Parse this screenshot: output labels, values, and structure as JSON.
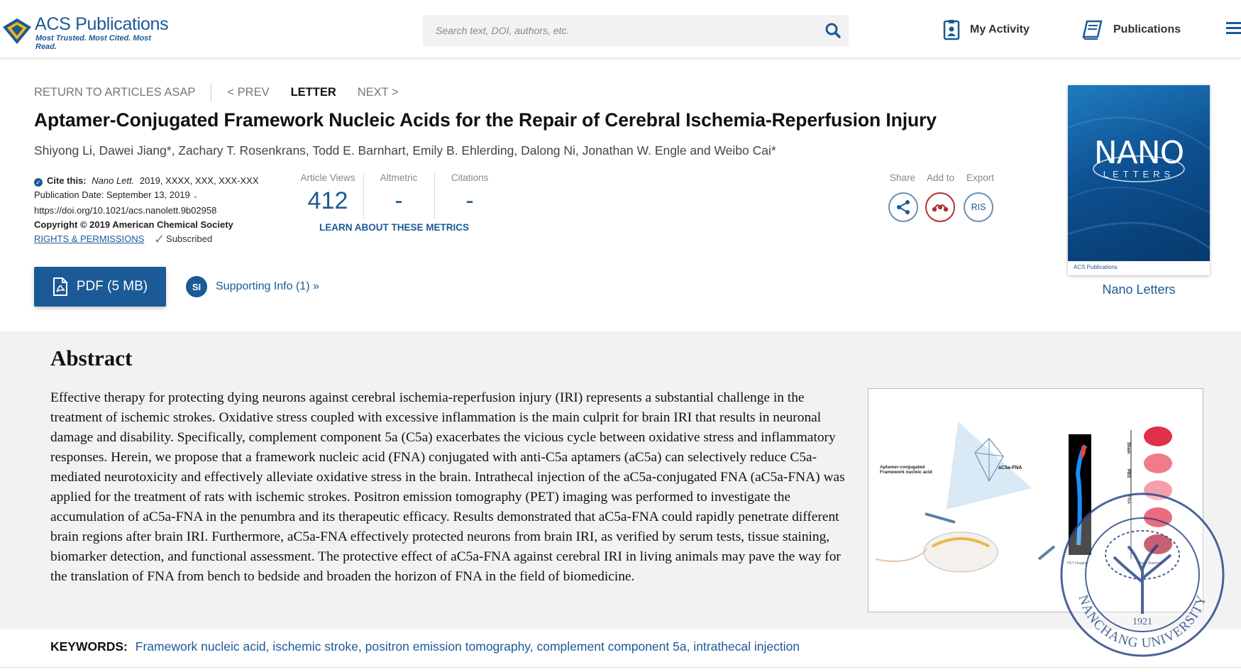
{
  "header": {
    "logo_name": "ACS Publications",
    "logo_tagline": "Most Trusted. Most Cited. Most Read.",
    "search_placeholder": "Search text, DOI, authors, etc.",
    "my_activity": "My Activity",
    "publications": "Publications",
    "brand_color": "#1b5a96"
  },
  "article_nav": {
    "return": "RETURN TO ARTICLES ASAP",
    "prev": "< PREV",
    "type": "LETTER",
    "next": "NEXT >"
  },
  "article": {
    "title": "Aptamer-Conjugated Framework Nucleic Acids for the Repair of Cerebral Ischemia-Reperfusion Injury",
    "authors": "Shiyong Li, Dawei Jiang*, Zachary T. Rosenkrans, Todd E. Barnhart, Emily B. Ehlerding, Dalong Ni, Jonathan W. Engle and Weibo Cai*"
  },
  "cite": {
    "label": "Cite this:",
    "journal": "Nano Lett.",
    "ref": "2019, XXXX, XXX, XXX-XXX",
    "pub_date": "Publication Date: September 13, 2019",
    "doi": "https://doi.org/10.1021/acs.nanolett.9b02958",
    "copyright": "Copyright © 2019 American Chemical Society",
    "rights": "RIGHTS & PERMISSIONS",
    "subscribed": "Subscribed"
  },
  "metrics": {
    "views_label": "Article Views",
    "views": "412",
    "altmetric_label": "Altmetric",
    "altmetric": "-",
    "citations_label": "Citations",
    "citations": "-",
    "learn": "LEARN ABOUT THESE METRICS"
  },
  "actions": {
    "share": "Share",
    "add_to": "Add to",
    "export": "Export",
    "ris": "RIS"
  },
  "buttons": {
    "pdf": "PDF (5 MB)",
    "si_badge": "SI",
    "supporting": "Supporting Info (1) »"
  },
  "journal": {
    "cover_title": "NANO",
    "cover_subtitle": "LETTERS",
    "cover_footer": "ACS Publications",
    "name": "Nano Letters"
  },
  "abstract": {
    "heading": "Abstract",
    "text": "Effective therapy for protecting dying neurons against cerebral ischemia-reperfusion injury (IRI) represents a substantial challenge in the treatment of ischemic strokes. Oxidative stress coupled with excessive inflammation is the main culprit for brain IRI that results in neuronal damage and disability. Specifically, complement component 5a (C5a) exacerbates the vicious cycle between oxidative stress and inflammatory responses. Herein, we propose that a framework nucleic acid (FNA) conjugated with anti-C5a aptamers (aC5a) can selectively reduce C5a-mediated neurotoxicity and effectively alleviate oxidative stress in the brain. Intrathecal injection of the aC5a-conjugated FNA (aC5a-FNA) was applied for the treatment of rats with ischemic strokes. Positron emission tomography (PET) imaging was performed to investigate the accumulation of aC5a-FNA in the penumbra and its therapeutic efficacy. Results demonstrated that aC5a-FNA could rapidly penetrate different brain regions after brain IRI. Furthermore, aC5a-FNA effectively protected neurons from brain IRI, as verified by serum tests, tissue staining, biomarker detection, and functional assessment. The protective effect of aC5a-FNA against cerebral IRI in living animals may pave the way for the translation of FNA from bench to bedside and broaden the horizon of FNA in the field of biomedicine.",
    "toc_labels": {
      "construct": "Aptamer-conjugated Framework nucleic acid",
      "fna": "aC5a-FNA",
      "sham": "Sham",
      "pbs": "PBS",
      "fna_group": "FNA",
      "pet": "PET imaging",
      "tissue": "Tissue Staining"
    }
  },
  "keywords": {
    "label": "KEYWORDS:",
    "list": "Framework nucleic acid, ischemic stroke, positron emission tomography, complement component 5a, intrathecal injection"
  },
  "watermark": {
    "year": "1921",
    "name": "NANCHANG UNIVERSITY"
  }
}
